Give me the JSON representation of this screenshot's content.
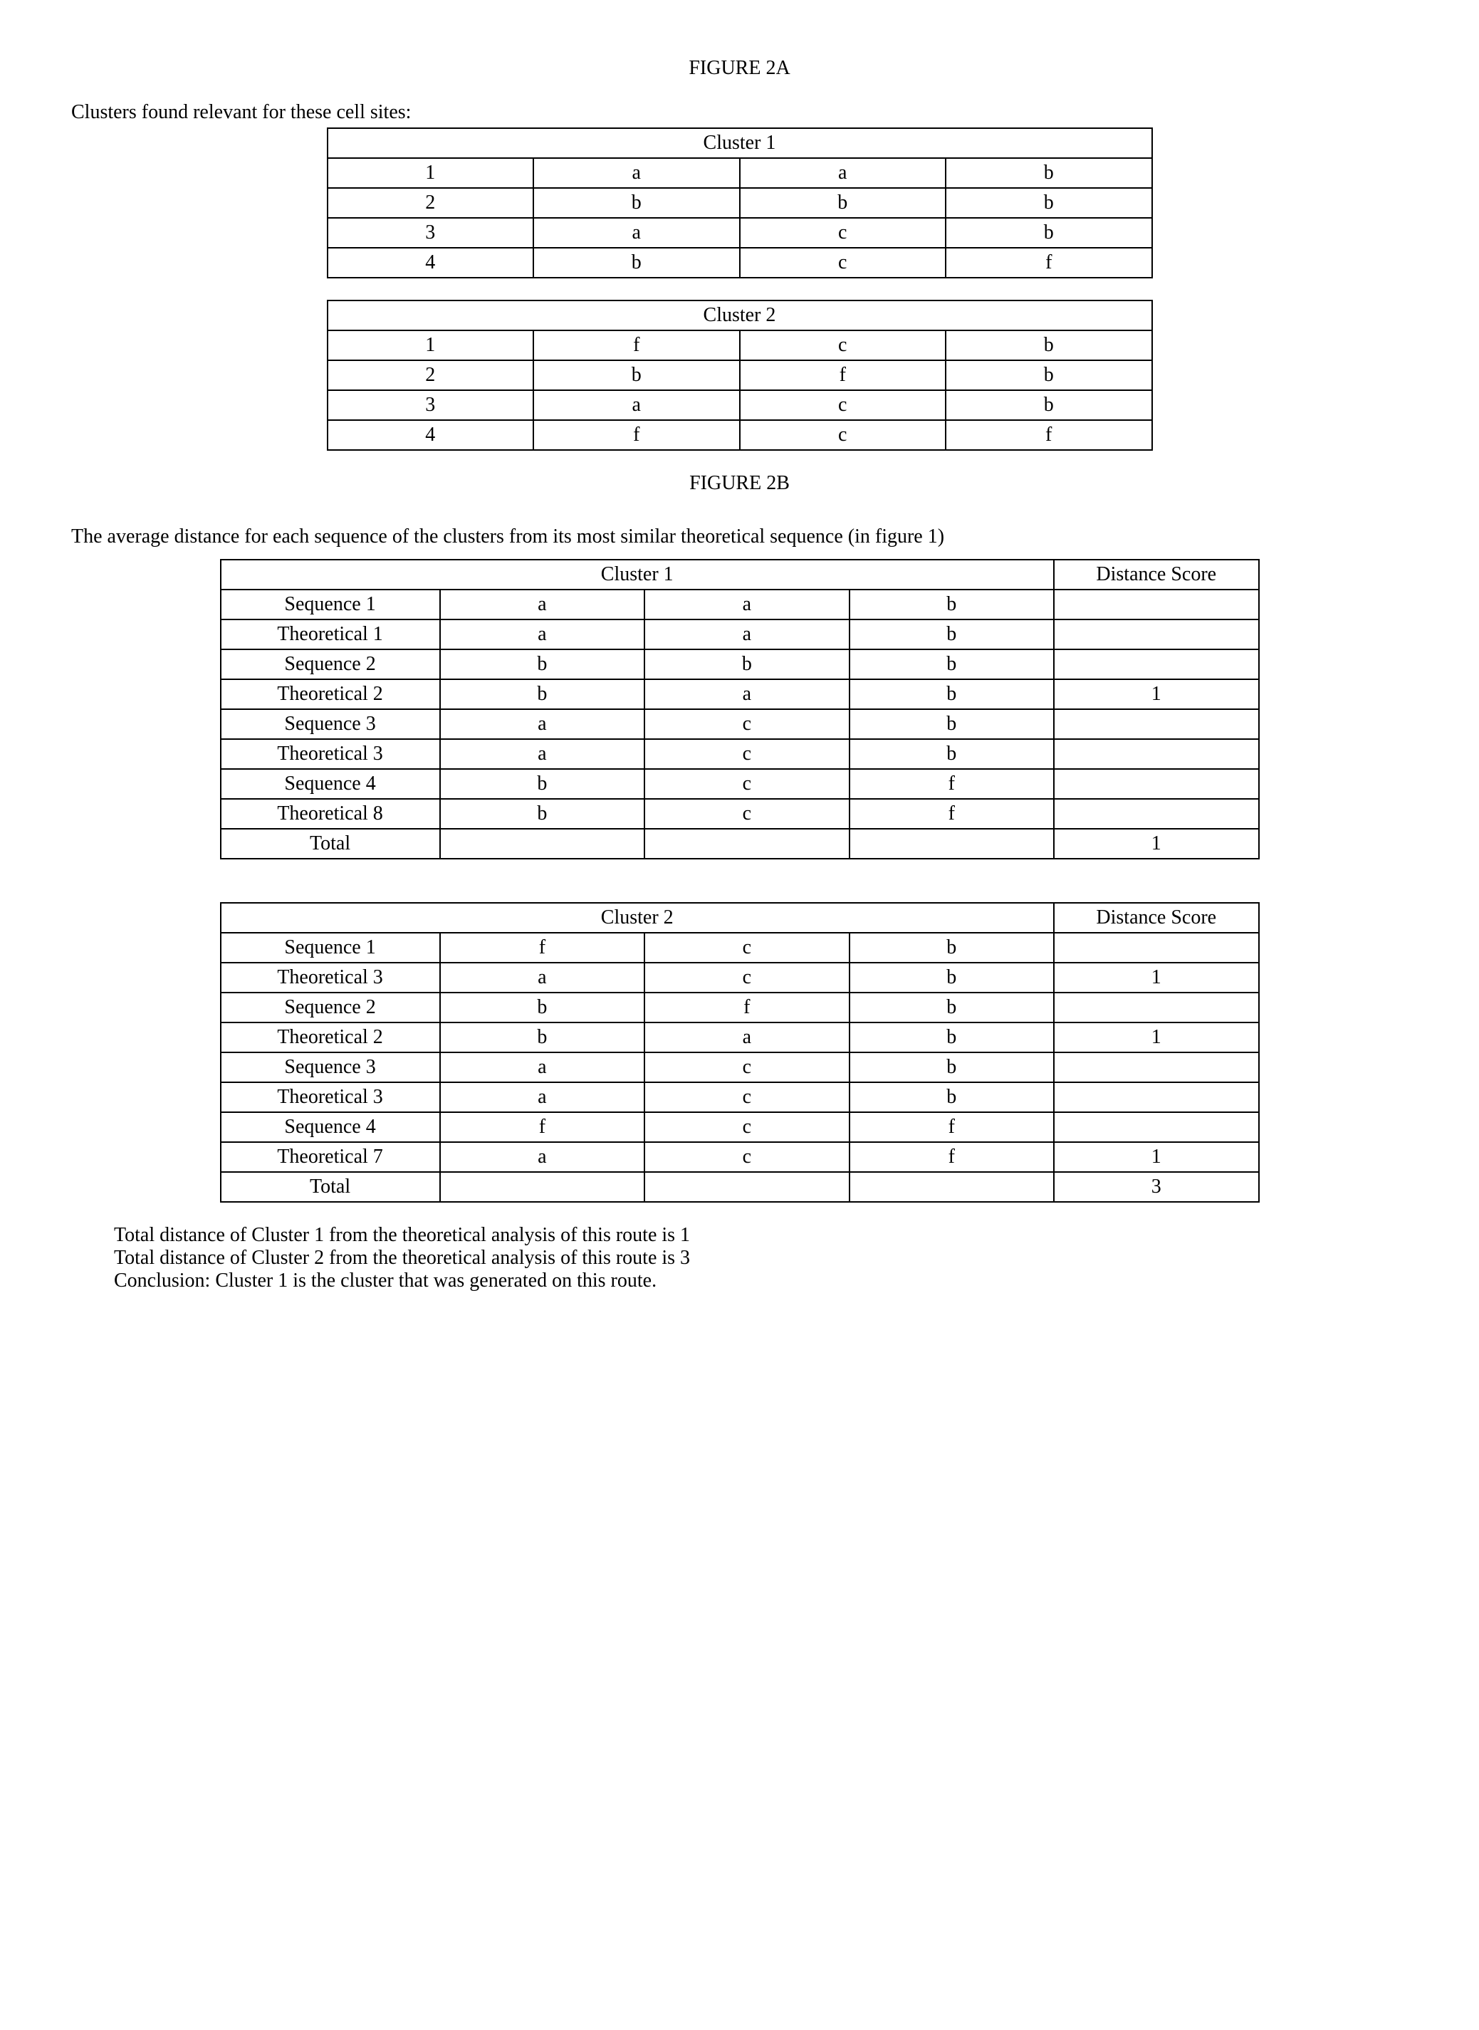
{
  "figure2a": {
    "title": "FIGURE 2A",
    "intro": "Clusters found relevant for these cell sites:",
    "cluster1": {
      "header": "Cluster 1",
      "rows": [
        [
          "1",
          "a",
          "a",
          "b"
        ],
        [
          "2",
          "b",
          "b",
          "b"
        ],
        [
          "3",
          "a",
          "c",
          "b"
        ],
        [
          "4",
          "b",
          "c",
          "f"
        ]
      ]
    },
    "cluster2": {
      "header": "Cluster 2",
      "rows": [
        [
          "1",
          "f",
          "c",
          "b"
        ],
        [
          "2",
          "b",
          "f",
          "b"
        ],
        [
          "3",
          "a",
          "c",
          "b"
        ],
        [
          "4",
          "f",
          "c",
          "f"
        ]
      ]
    }
  },
  "figure2b": {
    "title": "FIGURE 2B",
    "intro": "The average distance for each sequence of the clusters from its most similar theoretical sequence (in figure 1)",
    "cluster1": {
      "header": "Cluster 1",
      "distLabel": "Distance Score",
      "rows": [
        [
          "Sequence 1",
          "a",
          "a",
          "b",
          ""
        ],
        [
          "Theoretical 1",
          "a",
          "a",
          "b",
          ""
        ],
        [
          "Sequence 2",
          "b",
          "b",
          "b",
          ""
        ],
        [
          "Theoretical 2",
          "b",
          "a",
          "b",
          "1"
        ],
        [
          "Sequence 3",
          "a",
          "c",
          "b",
          ""
        ],
        [
          "Theoretical 3",
          "a",
          "c",
          "b",
          ""
        ],
        [
          "Sequence 4",
          "b",
          "c",
          "f",
          ""
        ],
        [
          "Theoretical 8",
          "b",
          "c",
          "f",
          ""
        ],
        [
          "Total",
          "",
          "",
          "",
          "1"
        ]
      ]
    },
    "cluster2": {
      "header": "Cluster 2",
      "distLabel": "Distance Score",
      "rows": [
        [
          "Sequence 1",
          "f",
          "c",
          "b",
          ""
        ],
        [
          "Theoretical 3",
          "a",
          "c",
          "b",
          "1"
        ],
        [
          "Sequence 2",
          "b",
          "f",
          "b",
          ""
        ],
        [
          "Theoretical 2",
          "b",
          "a",
          "b",
          "1"
        ],
        [
          "Sequence 3",
          "a",
          "c",
          "b",
          ""
        ],
        [
          "Theoretical 3",
          "a",
          "c",
          "b",
          ""
        ],
        [
          "Sequence 4",
          "f",
          "c",
          "f",
          ""
        ],
        [
          "Theoretical 7",
          "a",
          "c",
          "f",
          "1"
        ],
        [
          "Total",
          "",
          "",
          "",
          "3"
        ]
      ]
    },
    "footer": {
      "line1": "Total distance of Cluster 1 from the theoretical analysis of this route is 1",
      "line2": "Total distance of Cluster 2 from the theoretical analysis of this route is 3",
      "line3": "Conclusion: Cluster 1 is the cluster that was generated on this route."
    }
  }
}
